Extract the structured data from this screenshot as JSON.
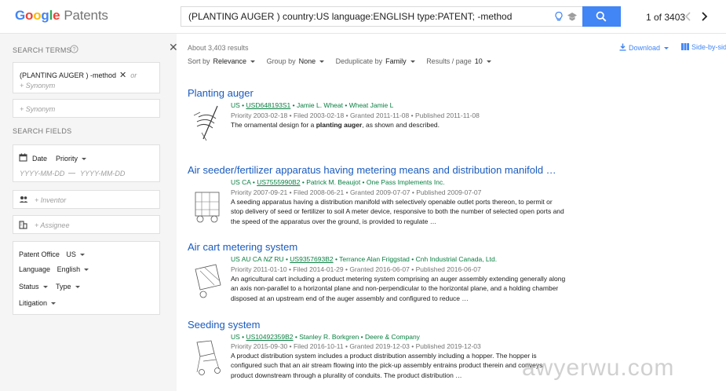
{
  "header": {
    "logo": {
      "g1": "G",
      "g2": "o",
      "g3": "o",
      "g4": "g",
      "g5": "l",
      "g6": "e",
      "product": "Patents"
    },
    "query": "(PLANTING AUGER ) country:US language:ENGLISH type:PATENT; -method",
    "pager": "1 of 3403",
    "icons": [
      "bulb-icon",
      "school-icon",
      "search-icon",
      "chevron-left-icon",
      "chevron-right-icon"
    ],
    "accent": "#4285f4"
  },
  "sidebar": {
    "search_terms_label": "SEARCH TERMS",
    "term": "(PLANTING AUGER ) -method",
    "term_close": "✕",
    "or": "or",
    "synonym_placeholder": "+ Synonym",
    "synonym_placeholder_2": "+ Synonym",
    "search_fields_label": "SEARCH FIELDS",
    "date_label": "Date",
    "date_type": "Priority",
    "date_from": "YYYY-MM-DD",
    "date_dash": "—",
    "date_to": "YYYY-MM-DD",
    "inventor_placeholder": "+ Inventor",
    "assignee_placeholder": "+ Assignee",
    "patent_office_label": "Patent Office",
    "patent_office_value": "US",
    "language_label": "Language",
    "language_value": "English",
    "status_label": "Status",
    "type_label": "Type",
    "litigation_label": "Litigation",
    "close": "✕"
  },
  "results_bar": {
    "count": "About 3,403 results",
    "sort_label": "Sort by",
    "sort_value": "Relevance",
    "group_label": "Group by",
    "group_value": "None",
    "dedupe_label": "Deduplicate by",
    "dedupe_value": "Family",
    "per_page_label": "Results / page",
    "per_page_value": "10",
    "download": "Download",
    "side_by_side": "Side-by-sid"
  },
  "results": [
    {
      "title": "Planting auger",
      "countries": "US",
      "pub": "USD648193S1",
      "parties": "Jamie L. Wheat • Wheat Jamie L",
      "dates": "Priority 2003-02-18 • Filed 2003-02-18 • Granted 2011-11-08 • Published 2011-11-08",
      "snippet_pre": "The ornamental design for a ",
      "snippet_bold": "planting auger",
      "snippet_post": ", as shown and described."
    },
    {
      "title": "Air seeder/fertilizer apparatus having metering means and distribution manifold …",
      "countries": "US CA",
      "pub": "US7555990B2",
      "parties": "Patrick M. Beaujot • One Pass Implements Inc.",
      "dates": "Priority 2007-09-21 • Filed 2008-06-21 • Granted 2009-07-07 • Published 2009-07-07",
      "snippet": "A seeding apparatus having a distribution manifold with selectively openable outlet ports thereon, to permit or stop delivery of seed or fertilizer to soil A meter device, responsive to both the number of selected open ports and the speed of the apparatus over the ground, is provided to regulate …"
    },
    {
      "title": "Air cart metering system",
      "countries": "US AU CA",
      "countries_italic": "NZ",
      "countries_post": "RU",
      "pub": "US9357693B2",
      "parties": "Terrance Alan Friggstad • Cnh Industrial Canada, Ltd.",
      "dates": "Priority 2011-01-10 • Filed 2014-01-29 • Granted 2016-06-07 • Published 2016-06-07",
      "snippet": "An agricultural cart including a product metering system comprising an auger assembly extending generally along an axis non-parallel to a horizontal plane and non-perpendicular to the horizontal plane, and a holding chamber disposed at an upstream end of the auger assembly and configured to reduce …"
    },
    {
      "title": "Seeding system",
      "countries": "US",
      "pub": "US10492359B2",
      "parties": "Stanley R. Borkgren • Deere & Company",
      "dates": "Priority 2015-09-30 • Filed 2016-10-11 • Granted 2019-12-03 • Published 2019-12-03",
      "snippet": "A product distribution system includes a product distribution assembly including a hopper. The hopper is configured such that an air stream flowing into the pick-up assembly entrains product therein and conveys product downstream through a plurality of conduits. The product distribution …"
    }
  ],
  "watermark": "awyerwu.com",
  "colors": {
    "title": "#1a5bbf",
    "meta": "#0b8043",
    "sidebar_bg": "#f5f5f5"
  }
}
